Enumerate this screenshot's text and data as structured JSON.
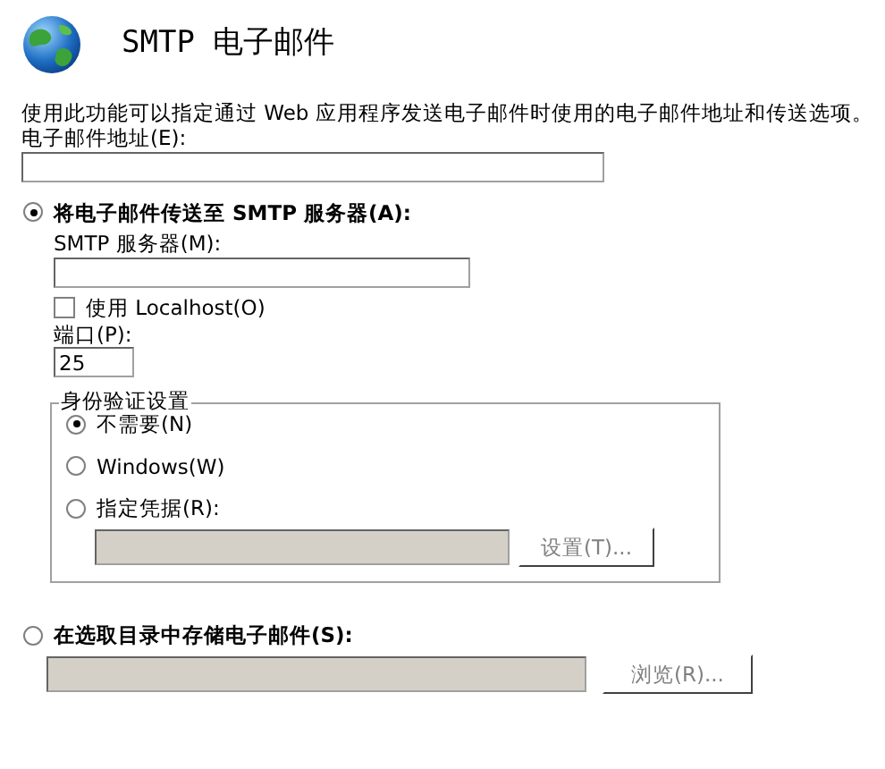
{
  "header": {
    "title": "SMTP 电子邮件"
  },
  "description": "使用此功能可以指定通过 Web 应用程序发送电子邮件时使用的电子邮件地址和传送选项。",
  "email_address": {
    "label": "电子邮件地址(E):"
  },
  "delivery_options": [
    {
      "kind": "smtp",
      "label": "将电子邮件传送至 SMTP 服务器(A):",
      "selected": true,
      "smtp_server": {
        "label": "SMTP 服务器(M):"
      },
      "use_localhost": {
        "label": "使用 Localhost(O)",
        "checked": false
      },
      "port": {
        "label": "端口(P):",
        "value": "25"
      },
      "authentication": {
        "title": "身份验证设置",
        "options": [
          {
            "label": "不需要(N)",
            "selected": true
          },
          {
            "label": "Windows(W)",
            "selected": false
          },
          {
            "label": "指定凭据(R):",
            "selected": false
          }
        ],
        "credentials_field": {
          "disabled": true
        },
        "set_button": {
          "label": "设置(T)...",
          "disabled": true
        }
      }
    },
    {
      "kind": "pickup",
      "label": "在选取目录中存储电子邮件(S):",
      "selected": false,
      "directory_field": {
        "disabled": true
      },
      "browse_button": {
        "label": "浏览(R)...",
        "disabled": true
      }
    }
  ]
}
